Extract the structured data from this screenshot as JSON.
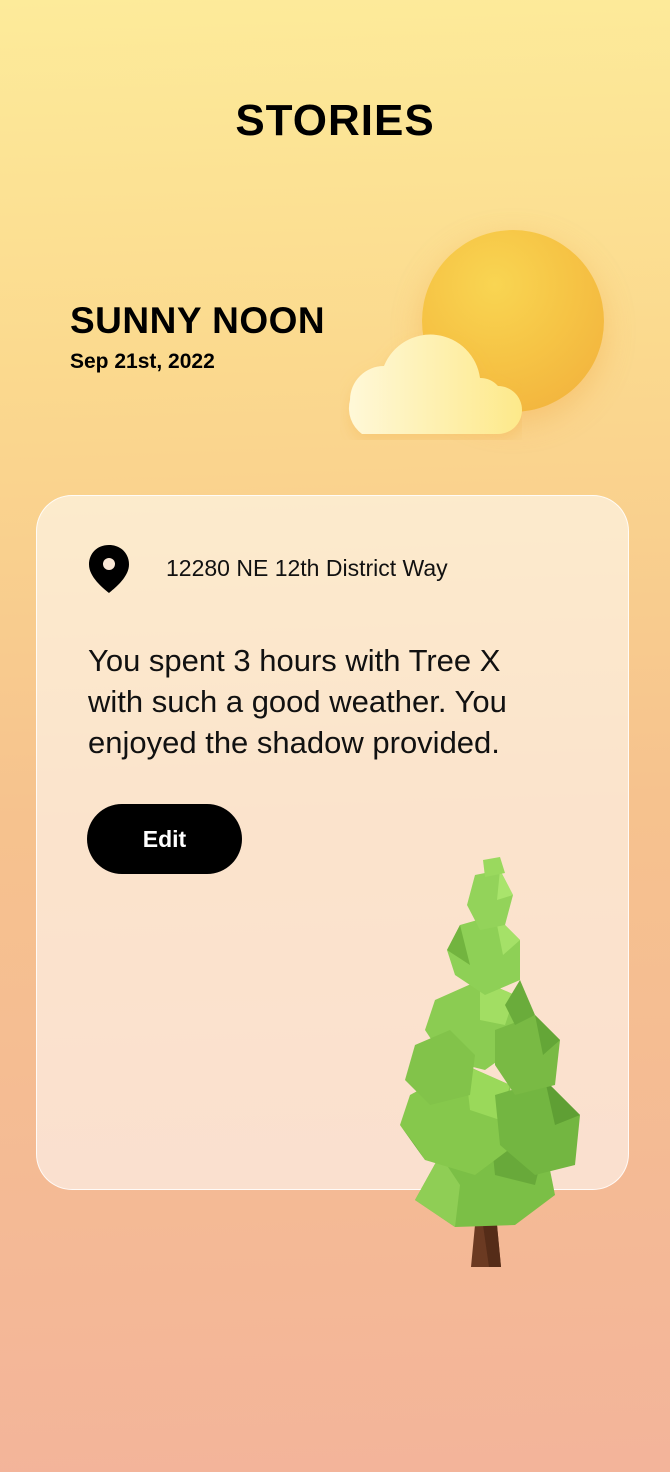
{
  "header": {
    "title": "STORIES"
  },
  "story": {
    "title": "SUNNY NOON",
    "date": "Sep 21st, 2022",
    "weather_icon": "sun-behind-cloud-icon"
  },
  "card": {
    "location_icon": "location-pin-icon",
    "address": "12280 NE 12th District Way",
    "text": "You spent 3 hours with Tree X with such a good weather. You enjoyed the shadow provided.",
    "edit_label": "Edit",
    "illustration": "tree-icon"
  },
  "colors": {
    "background_top": "#fdeb9a",
    "background_bottom": "#f3b49a",
    "button": "#000000",
    "sun": "#f6c445",
    "tree_green": "#7cc24a"
  }
}
